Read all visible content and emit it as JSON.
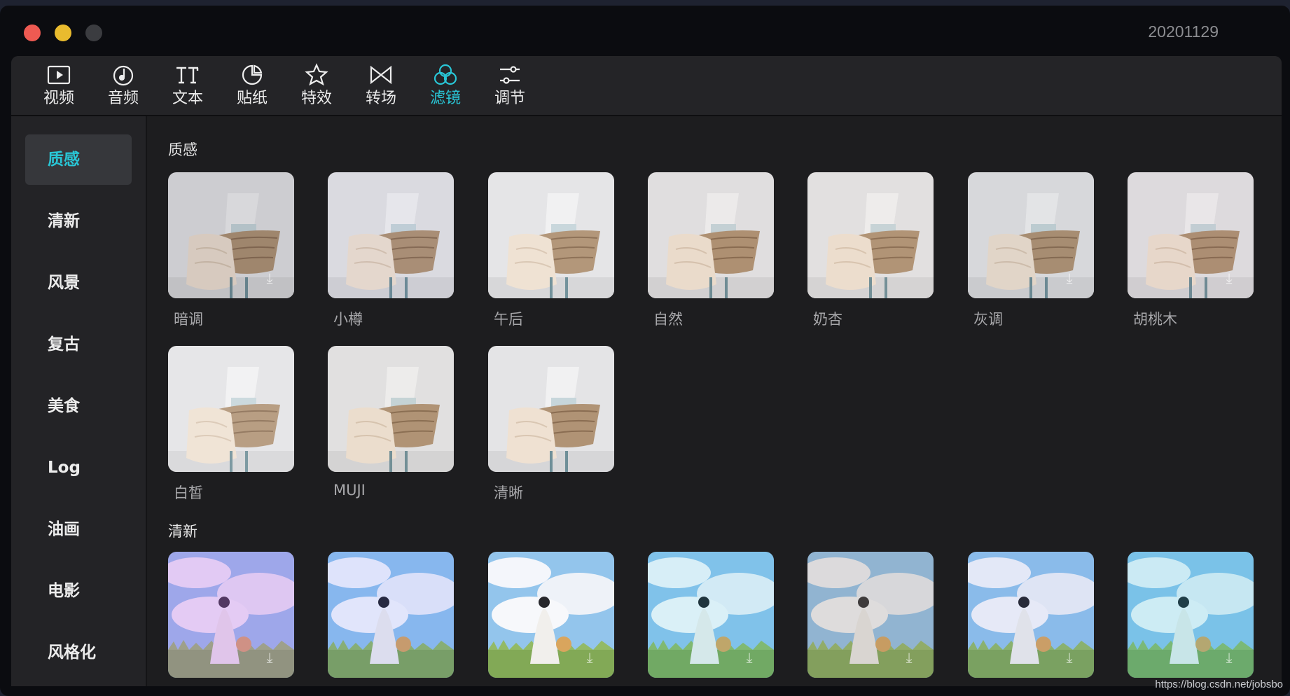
{
  "window": {
    "title": "20201129",
    "controls": [
      "close",
      "minimize",
      "zoom"
    ]
  },
  "toolbar": {
    "active_tab": "滤镜",
    "active_color": "#29c6d6",
    "tabs": [
      {
        "label": "视频",
        "icon": "video-icon"
      },
      {
        "label": "音频",
        "icon": "audio-icon"
      },
      {
        "label": "文本",
        "icon": "text-icon"
      },
      {
        "label": "贴纸",
        "icon": "sticker-icon"
      },
      {
        "label": "特效",
        "icon": "effects-icon"
      },
      {
        "label": "转场",
        "icon": "transition-icon"
      },
      {
        "label": "滤镜",
        "icon": "filter-icon"
      },
      {
        "label": "调节",
        "icon": "adjust-icon"
      }
    ]
  },
  "sidebar": {
    "active": "质感",
    "items": [
      {
        "label": "质感"
      },
      {
        "label": "清新"
      },
      {
        "label": "风景"
      },
      {
        "label": "复古"
      },
      {
        "label": "美食"
      },
      {
        "label": "Log"
      },
      {
        "label": "油画"
      },
      {
        "label": "电影"
      },
      {
        "label": "风格化"
      }
    ]
  },
  "sections": [
    {
      "title": "质感",
      "filters": [
        {
          "label": "暗调",
          "downloadable": true
        },
        {
          "label": "小樽",
          "downloadable": false
        },
        {
          "label": "午后",
          "downloadable": false
        },
        {
          "label": "自然",
          "downloadable": false
        },
        {
          "label": "奶杏",
          "downloadable": false
        },
        {
          "label": "灰调",
          "downloadable": true
        },
        {
          "label": "胡桃木",
          "downloadable": true
        },
        {
          "label": "白皙",
          "downloadable": false
        },
        {
          "label": "MUJI",
          "downloadable": false
        },
        {
          "label": "清晰",
          "downloadable": false
        }
      ]
    },
    {
      "title": "清新",
      "filters": [
        {
          "label": "",
          "downloadable": true
        },
        {
          "label": "",
          "downloadable": false
        },
        {
          "label": "",
          "downloadable": true
        },
        {
          "label": "",
          "downloadable": true
        },
        {
          "label": "",
          "downloadable": true
        },
        {
          "label": "",
          "downloadable": true
        },
        {
          "label": "",
          "downloadable": true
        }
      ]
    }
  ],
  "download_glyph": "⤓",
  "watermark": "https://blog.csdn.net/jobsbo"
}
